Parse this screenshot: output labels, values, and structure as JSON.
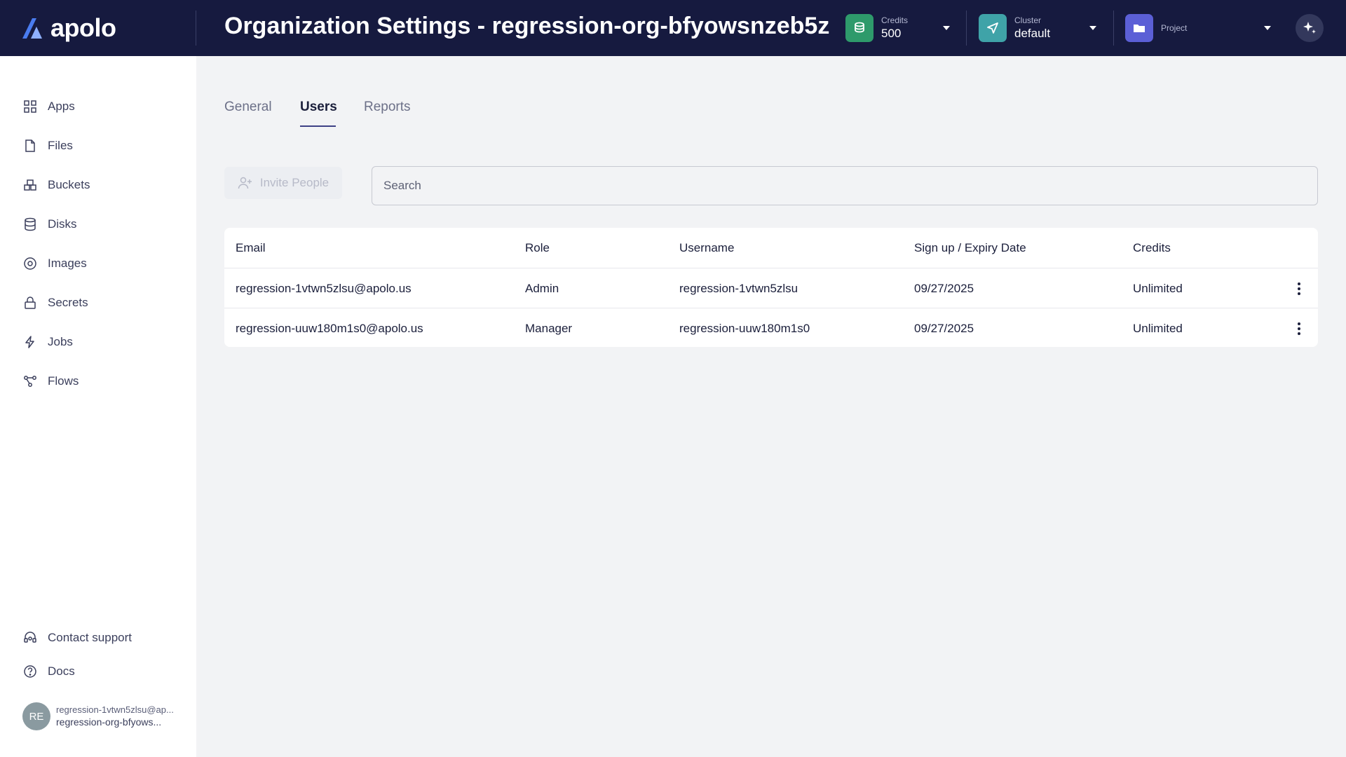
{
  "app": {
    "logo_text": "apolo",
    "page_title": "Organization Settings - regression-org-bfyowsnzeb5z"
  },
  "header": {
    "credits": {
      "label": "Credits",
      "value": "500",
      "icon": "coins-icon",
      "color": "#2e9a6b"
    },
    "cluster": {
      "label": "Cluster",
      "value": "default",
      "icon": "send-icon",
      "color": "#3fa3a8"
    },
    "project": {
      "label": "Project",
      "value": "",
      "icon": "folder-icon",
      "color": "#5b5fd6"
    },
    "assistant_icon": "sparkle-icon"
  },
  "sidebar": {
    "items": [
      {
        "label": "Apps",
        "icon": "apps-grid-icon"
      },
      {
        "label": "Files",
        "icon": "file-icon"
      },
      {
        "label": "Buckets",
        "icon": "buckets-icon"
      },
      {
        "label": "Disks",
        "icon": "database-icon"
      },
      {
        "label": "Images",
        "icon": "image-disc-icon"
      },
      {
        "label": "Secrets",
        "icon": "lock-icon"
      },
      {
        "label": "Jobs",
        "icon": "lightning-icon"
      },
      {
        "label": "Flows",
        "icon": "flow-icon"
      }
    ],
    "footer": [
      {
        "label": "Contact support",
        "icon": "headset-icon"
      },
      {
        "label": "Docs",
        "icon": "help-circle-icon"
      }
    ],
    "user": {
      "initials": "RE",
      "email": "regression-1vtwn5zlsu@ap...",
      "org": "regression-org-bfyows..."
    }
  },
  "tabs": [
    {
      "label": "General",
      "active": false
    },
    {
      "label": "Users",
      "active": true
    },
    {
      "label": "Reports",
      "active": false
    }
  ],
  "toolbar": {
    "invite_label": "Invite People",
    "search_placeholder": "Search"
  },
  "table": {
    "columns": [
      "Email",
      "Role",
      "Username",
      "Sign up / Expiry Date",
      "Credits"
    ],
    "rows": [
      {
        "email": "regression-1vtwn5zlsu@apolo.us",
        "role": "Admin",
        "username": "regression-1vtwn5zlsu",
        "date": "09/27/2025",
        "credits": "Unlimited"
      },
      {
        "email": "regression-uuw180m1s0@apolo.us",
        "role": "Manager",
        "username": "regression-uuw180m1s0",
        "date": "09/27/2025",
        "credits": "Unlimited"
      }
    ]
  },
  "colors": {
    "header_bg": "#161a3f",
    "accent": "#3d4185",
    "page_bg": "#f2f3f5"
  }
}
